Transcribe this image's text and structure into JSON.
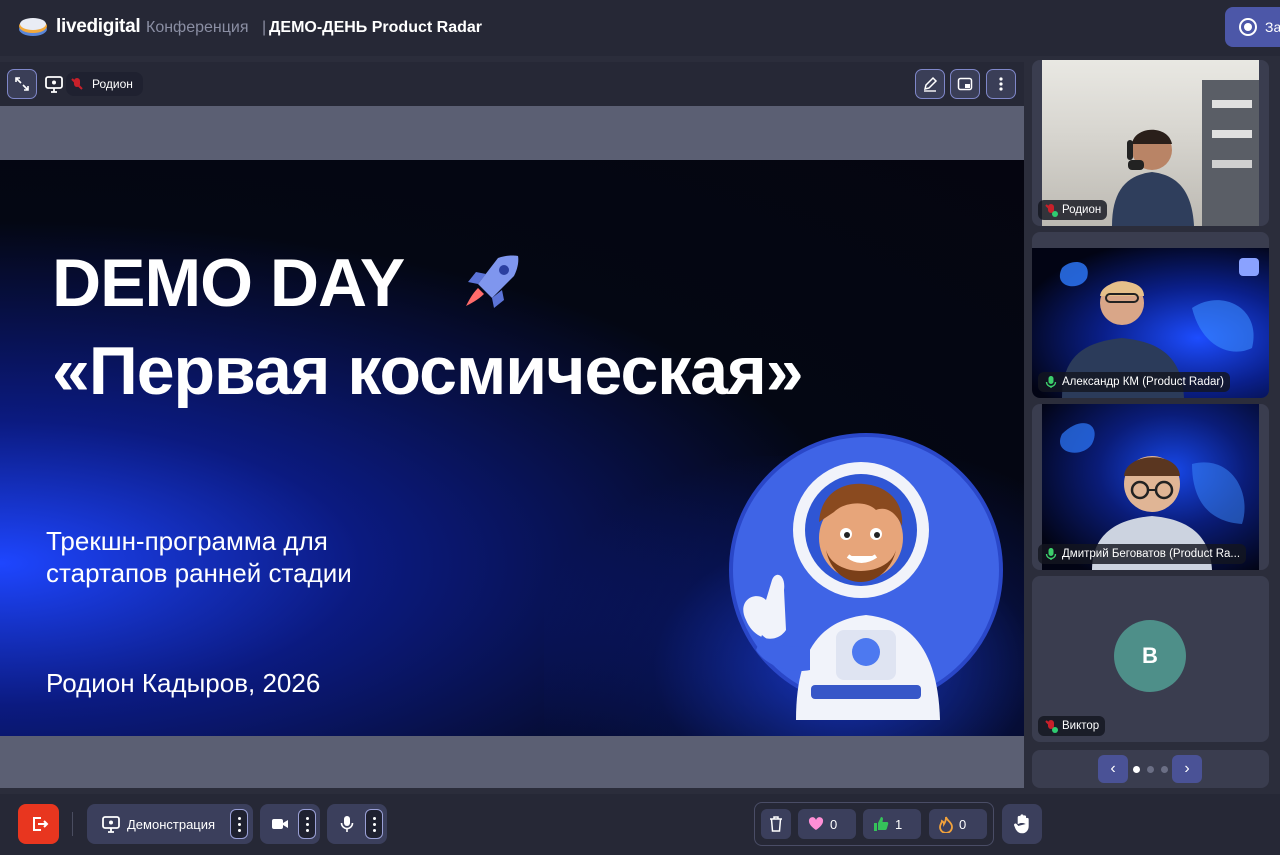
{
  "app": {
    "logo_text": "livedigital",
    "conference_label": "Конференция",
    "separator": "|",
    "conference_title": "ДЕМО-ДЕНЬ Product Radar",
    "top_button_label": "За"
  },
  "stage": {
    "presenter_name": "Родион",
    "slide": {
      "title_line1": "DEMO DAY",
      "title_line2": "«Первая космическая»",
      "subtitle_line1": "Трекшн-программа для",
      "subtitle_line2": "стартапов ранней стадии",
      "author": "Родион Кадыров, 2026"
    }
  },
  "participants": [
    {
      "name": "Родион",
      "mic": "muted",
      "avatar_letter": ""
    },
    {
      "name": "Александр КМ (Product Radar)",
      "mic": "on",
      "avatar_letter": ""
    },
    {
      "name": "Дмитрий Беговатов (Product Ra...",
      "mic": "on",
      "avatar_letter": ""
    },
    {
      "name": "Виктор",
      "mic": "muted",
      "avatar_letter": "B"
    }
  ],
  "pager": {
    "prev": "‹",
    "next": "›",
    "pages": 3,
    "current": 1
  },
  "toolbar": {
    "demo_label": "Демонстрация",
    "reactions": {
      "hearts": "0",
      "thumbs": "1",
      "fire": "0"
    }
  },
  "colors": {
    "accent": "#4c57a8",
    "leave": "#e8361f",
    "background": "#2b2d3b",
    "avatar_viktor": "#4e8f89"
  }
}
